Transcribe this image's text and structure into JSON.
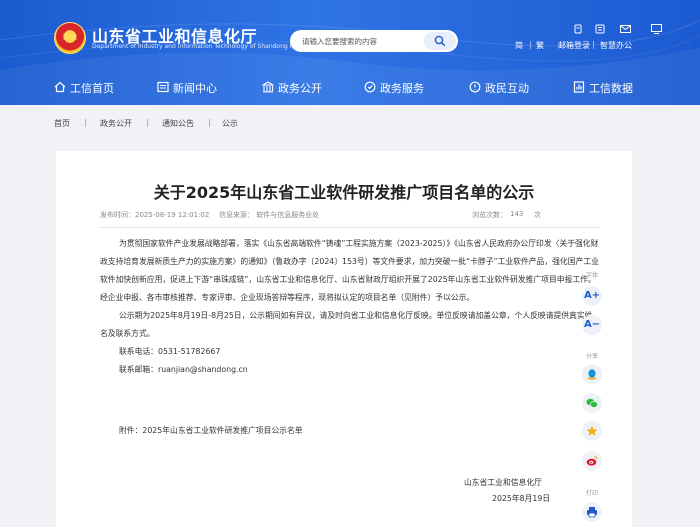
{
  "header": {
    "emblem_text": "国徽",
    "site_title": "山东省工业和信息化厅",
    "site_subtitle": "Department of Industry and Information Technology of Shandong Province",
    "search": {
      "placeholder": "请输入您要搜索的内容"
    },
    "tool_links": [
      "简",
      "繁",
      "邮箱登录",
      "智慧办公"
    ]
  },
  "nav": {
    "items": [
      {
        "label": "工信首页",
        "icon": "home-icon"
      },
      {
        "label": "新闻中心",
        "icon": "news-icon"
      },
      {
        "label": "政务公开",
        "icon": "government-icon"
      },
      {
        "label": "政务服务",
        "icon": "service-icon"
      },
      {
        "label": "政民互动",
        "icon": "interaction-icon"
      },
      {
        "label": "工信数据",
        "icon": "data-icon"
      }
    ]
  },
  "breadcrumb": {
    "items": [
      "首页",
      "政务公开",
      "通知公告",
      "公示"
    ],
    "separator": "|"
  },
  "article": {
    "title": "关于2025年山东省工业软件研发推广项目名单的公示",
    "published": "发布时间：2025-08-19 12:01:02",
    "source": "信息来源：  软件与信息服务业处",
    "views_label": "浏览次数：",
    "views_count": "143",
    "views_unit": "次",
    "paragraph1": "为贯彻国家软件产业发展战略部署，落实《山东省高端软件“铸魂”工程实施方案（2023-2025）》《山东省人民政府办公厅印发〈关于强化财政支持培育发展新质生产力的实施方案〉的通知》（鲁政办字〔2024〕153号）等文件要求，加力突破一批“卡脖子”工业软件产品，强化国产工业软件加快创新应用，促进上下游“串珠成链”，山东省工业和信息化厅、山东省财政厅组织开展了2025年山东省工业软件研发推广项目申报工作。经企业申报、各市审核推荐、专家评审、企业现场答辩等程序，现将拟认定的项目名单（见附件）予以公示。",
    "paragraph2": "公示期为2025年8月19日-8月25日，公示期间如有异议，请及时向省工业和信息化厅反映。单位反映请加盖公章，个人反映请提供真实姓名及联系方式。",
    "phone": "联系电话：0531-51782667",
    "email": "联系邮箱：ruanjian@shandong.cn",
    "attachment": "附件：2025年山东省工业软件研发推广项目公示名单",
    "signature_org": "山东省工业和信息化厅",
    "signature_date": "2025年8月19日"
  },
  "side_toolbar": {
    "font_label": "字体",
    "font_increase": "A+",
    "font_decrease": "A−",
    "share_label": "分享",
    "print_label": "打印"
  },
  "colors": {
    "brand_blue": "#1d5ad0",
    "header_light": "#2f74e6",
    "page_bg": "#f0f2f5"
  }
}
